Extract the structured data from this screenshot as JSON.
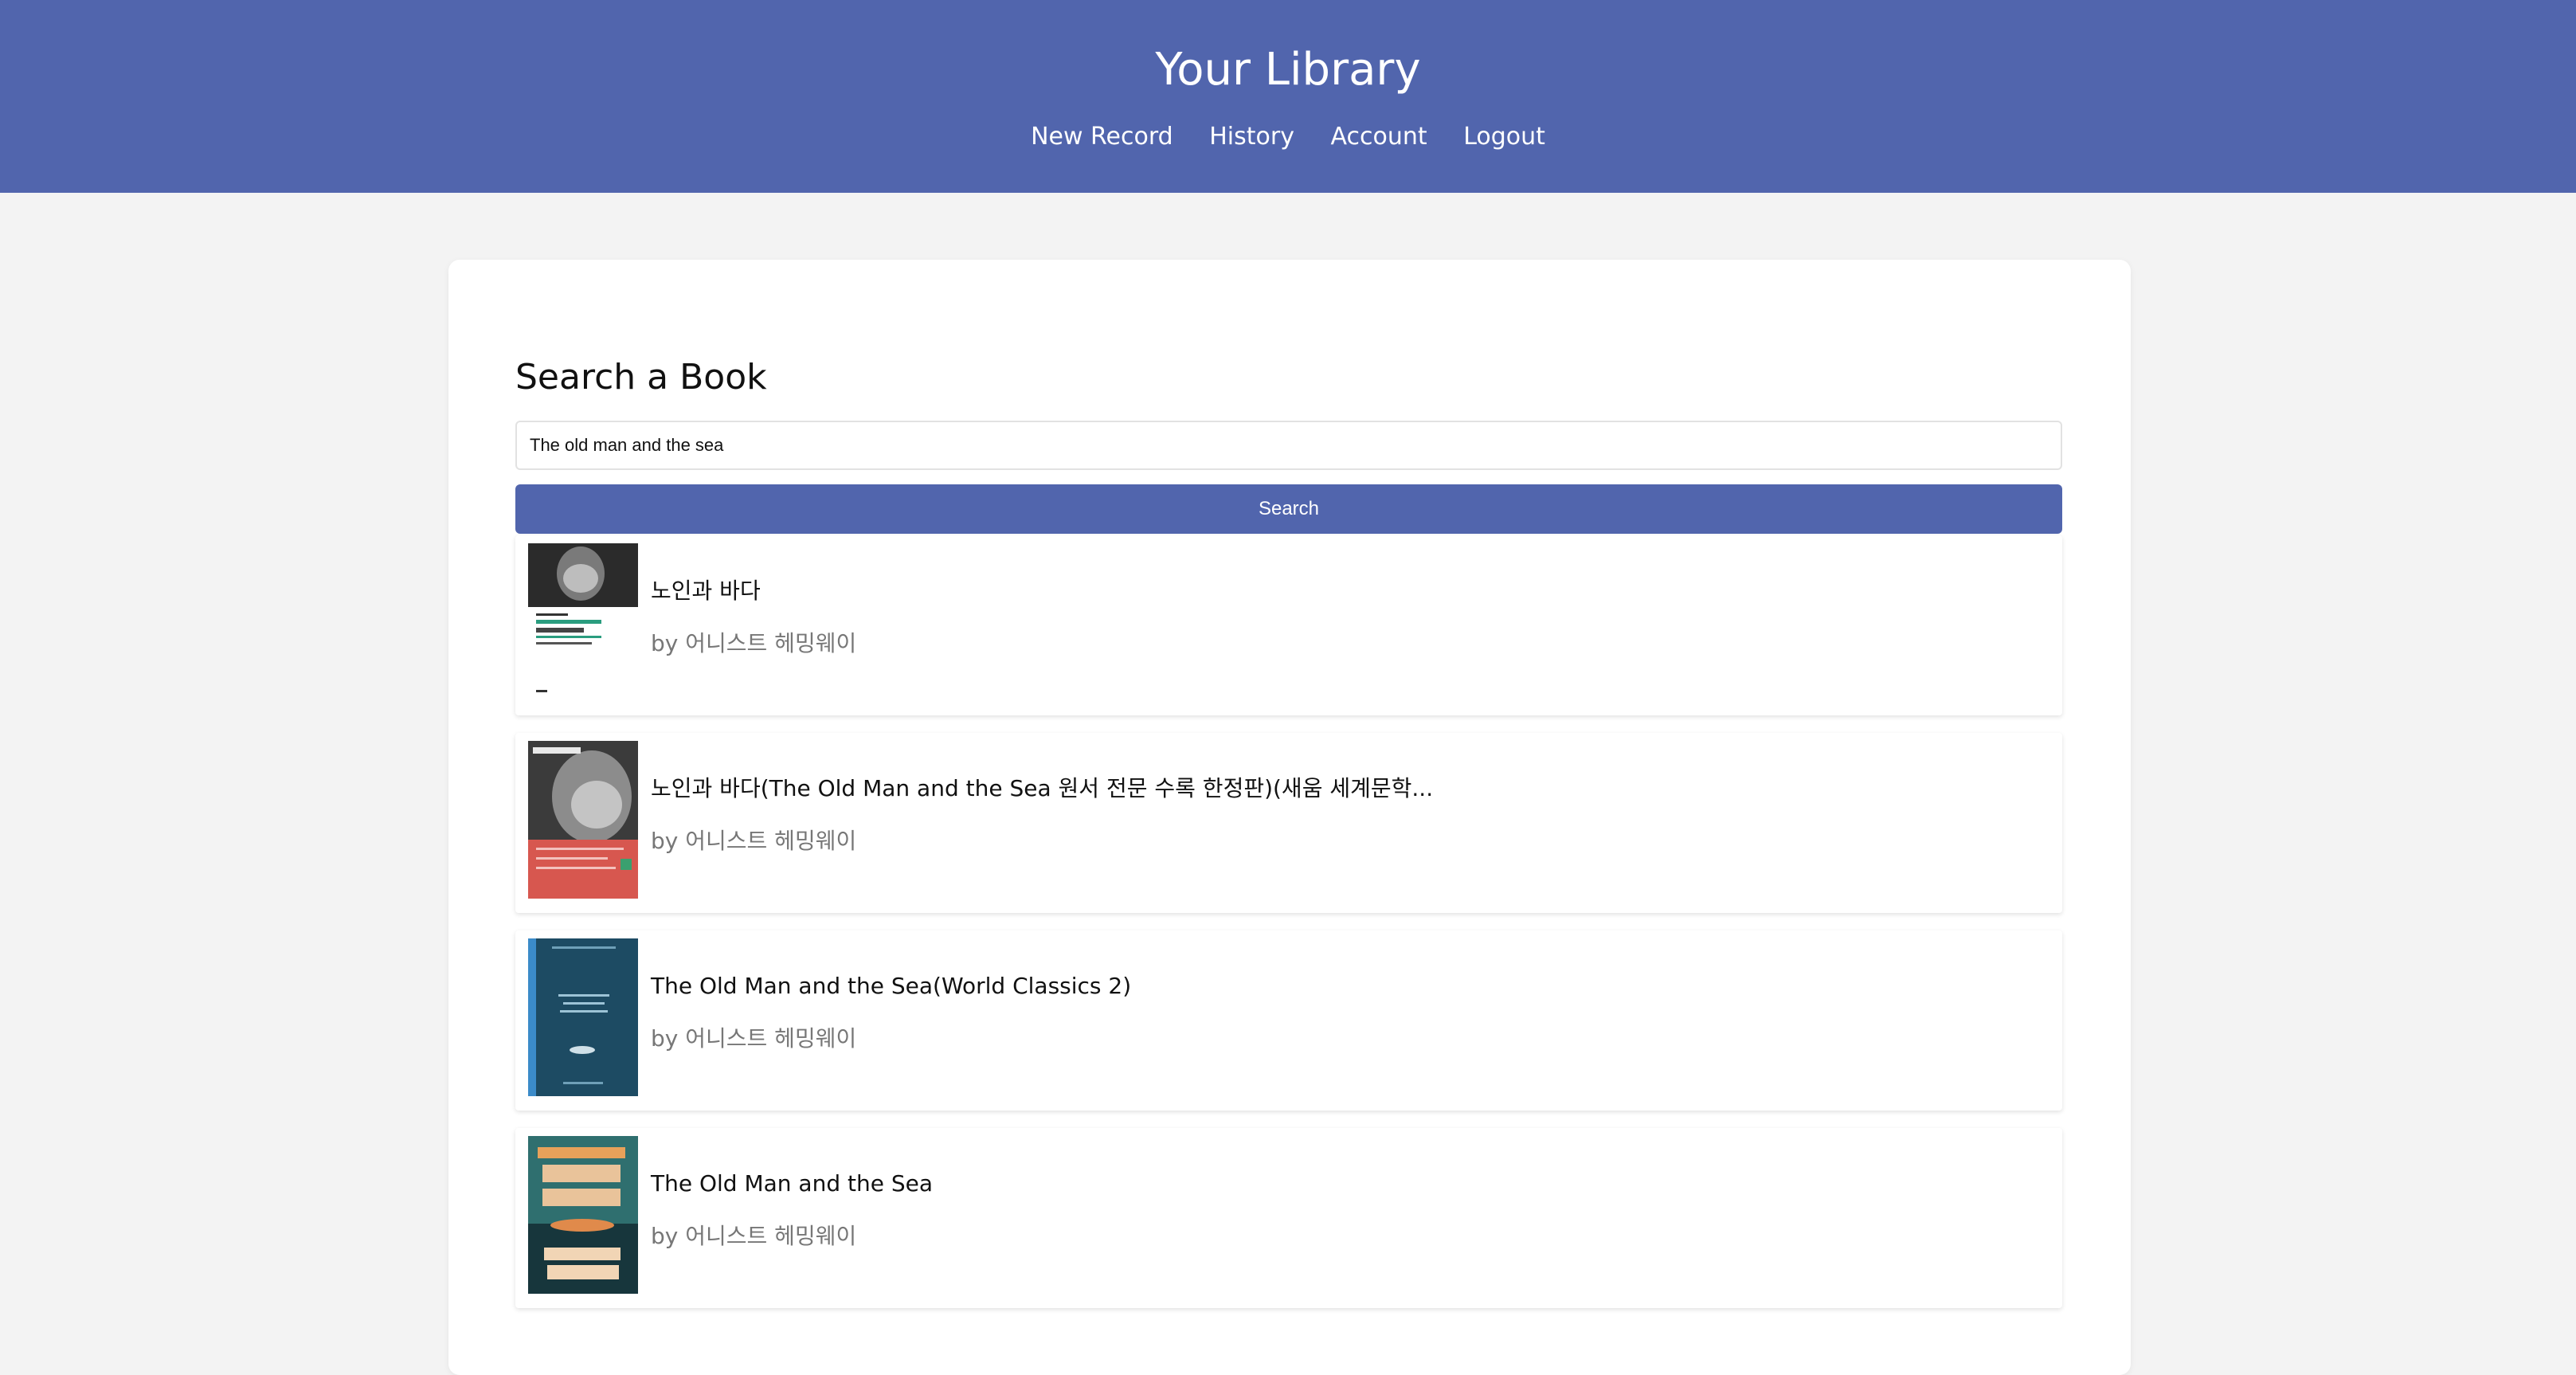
{
  "header": {
    "title": "Your Library",
    "nav": [
      "New Record",
      "History",
      "Account",
      "Logout"
    ]
  },
  "search": {
    "heading": "Search a Book",
    "query": "The old man and the sea",
    "button_label": "Search"
  },
  "results": [
    {
      "title": "노인과 바다",
      "author": "by 어니스트 헤밍웨이",
      "cover_icon": "book-cover-portrait-icon"
    },
    {
      "title": "노인과 바다(The Old Man and the Sea 원서 전문 수록 한정판)(새움 세계문학...",
      "author": "by 어니스트 헤밍웨이",
      "cover_icon": "book-cover-sepia-icon"
    },
    {
      "title": "The Old Man and the Sea(World Classics 2)",
      "author": "by 어니스트 헤밍웨이",
      "cover_icon": "book-cover-blue-icon"
    },
    {
      "title": "The Old Man and the Sea",
      "author": "by 어니스트 헤밍웨이",
      "cover_icon": "book-cover-teal-icon"
    }
  ],
  "colors": {
    "header_bg": "#5165ad",
    "page_bg": "#f3f3f3",
    "button_bg": "#5165ad",
    "author_text": "#777777"
  }
}
